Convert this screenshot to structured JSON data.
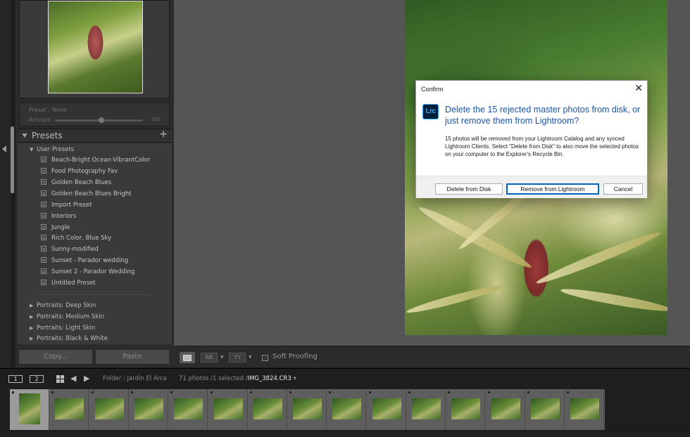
{
  "left_panel": {
    "preset_amount": {
      "preset_label": "Preset :  None",
      "amount_label": "Amount",
      "amount_value": "100"
    },
    "presets_section": {
      "title": "Presets",
      "add_symbol": "+"
    },
    "groups": [
      {
        "label": "User Presets",
        "expanded": true
      },
      {
        "label": "Portraits: Deep Skin",
        "expanded": false
      },
      {
        "label": "Portraits: Medium Skin",
        "expanded": false
      },
      {
        "label": "Portraits: Light Skin",
        "expanded": false
      },
      {
        "label": "Portraits: Black & White",
        "expanded": false
      }
    ],
    "user_presets": [
      "Beach-Bright Ocean-VibrantColor",
      "Food Photography Fav",
      "Golden Beach Blues",
      "Golden Beach Blues Bright",
      "Import Preset",
      "Interiors",
      "Jungle",
      "Rich Color, Blue Sky",
      "Sunny-modified",
      "Sunset - Parador wedding",
      "Sunset 2 - Parador Wedding",
      "Untitled Preset"
    ],
    "copy_label": "Copy...",
    "paste_label": "Paste"
  },
  "toolbar": {
    "compare_label": "RA",
    "survey_label": "YY",
    "soft_proofing_label": "Soft Proofing"
  },
  "filmstrip_header": {
    "screen1": "1",
    "screen2": "2",
    "folder_label": "Folder : Jardin El Arca",
    "count_label": "71 photos /1 selected /",
    "filename": "IMG_3824.CR3",
    "dropdown": "▾"
  },
  "filmstrip": {
    "thumbnail_count": 15,
    "selected_index": 0
  },
  "dialog": {
    "title": "Confirm",
    "close_symbol": "✕",
    "logo_text": "Lrc",
    "main_message": "Delete the 15 rejected master photos from disk, or just remove them from Lightroom?",
    "sub_message": "15 photos will be removed from your Lightroom Catalog and any synced Lightroom Clients. Select \"Delete from Disk\" to also move the selected photos on your computer to the Explorer's Recycle Bin.",
    "buttons": {
      "delete_from_disk": "Delete from Disk",
      "remove_from_lightroom": "Remove from Lightroom",
      "cancel": "Cancel"
    }
  },
  "colors": {
    "dialog_heading": "#1a56a8",
    "default_button_border": "#0067c0",
    "lrc_logo_bg": "#001e36",
    "lrc_logo_fg": "#31a8ff"
  }
}
